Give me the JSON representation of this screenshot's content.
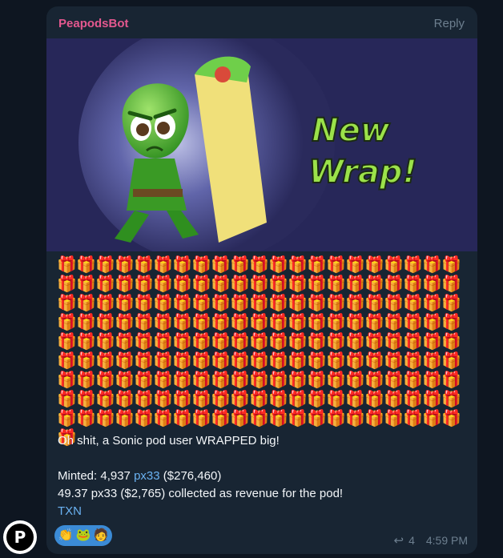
{
  "message": {
    "sender": "PeapodsBot",
    "reply_label": "Reply",
    "banner_text_line1": "New",
    "banner_text_line2": "Wrap!",
    "gift_emoji": "🎁",
    "gift_count": 190,
    "body": {
      "line1": "Oh shit, a Sonic pod user WRAPPED big!",
      "minted_prefix": "Minted: 4,937 ",
      "minted_token": "px33",
      "minted_suffix": " ($276,460)",
      "line3": "49.37 px33 ($2,765) collected as revenue for the pod!",
      "txn": "TXN"
    },
    "reactions": [
      {
        "name": "clap-reaction",
        "glyph": "👏"
      },
      {
        "name": "frog-reaction",
        "glyph": "🐸"
      },
      {
        "name": "person-reaction",
        "glyph": "🧑"
      }
    ],
    "forward_count": "4",
    "time": "4:59 PM",
    "avatar_letter": "P"
  },
  "colors": {
    "background": "#0e1621",
    "bubble": "#182533",
    "sender": "#e4588f",
    "link": "#6ab2f2",
    "banner_text": "#9be24a"
  }
}
